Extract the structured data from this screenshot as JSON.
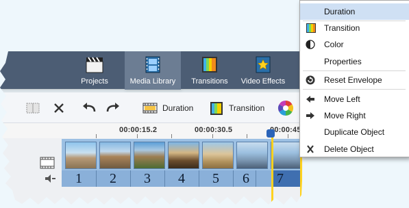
{
  "tabs": [
    {
      "label": "Projects",
      "icon": "clapperboard-icon"
    },
    {
      "label": "Media Library",
      "icon": "film-icon"
    },
    {
      "label": "Transitions",
      "icon": "transition-icon"
    },
    {
      "label": "Video Effects",
      "icon": "star-film-icon"
    }
  ],
  "toolbar": {
    "duration_label": "Duration",
    "transition_label": "Transition"
  },
  "timeline": {
    "time_labels": [
      "00:00:15.2",
      "00:00:30.5",
      "00:00:45"
    ],
    "clip_numbers": [
      "1",
      "2",
      "3",
      "4",
      "5",
      "6",
      "7"
    ]
  },
  "context_menu": {
    "items": [
      {
        "label": "Duration",
        "icon": ""
      },
      {
        "label": "Transition",
        "icon": "transition-icon"
      },
      {
        "label": "Color",
        "icon": "color-icon"
      },
      {
        "label": "Properties",
        "icon": ""
      },
      {
        "label": "Reset Envelope",
        "icon": "reset-icon"
      },
      {
        "label": "Move Left",
        "icon": "arrow-left-icon"
      },
      {
        "label": "Move Right",
        "icon": "arrow-right-icon"
      },
      {
        "label": "Duplicate Object",
        "icon": ""
      },
      {
        "label": "Delete Object",
        "icon": "delete-icon"
      }
    ]
  },
  "colors": {
    "topbar": "#4c5d74",
    "selection": "#cfe0f4",
    "playhead": "#ffd21f",
    "clip_blue": "#8ab0d9"
  }
}
